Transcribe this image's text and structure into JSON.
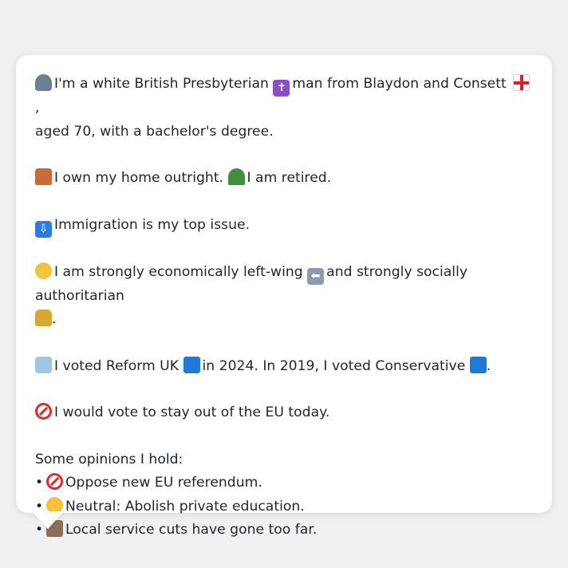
{
  "persona": {
    "intro": {
      "icon1": "person-icon",
      "text1": "I'm a white British Presbyterian",
      "icon2": "latin-cross-icon",
      "text2": "man from Blaydon and Consett",
      "icon3": "england-flag-icon",
      "text3": ",",
      "text4": "aged 70, with a bachelor's degree."
    },
    "home": {
      "icon1": "house-icon",
      "text1": "I own my home outright.",
      "icon2": "palm-tree-icon",
      "text2": "I am retired."
    },
    "issue": {
      "icon": "passport-control-icon",
      "text": "Immigration is my top issue."
    },
    "ideology": {
      "icon1": "thinking-face-icon",
      "text1": "I am strongly economically left-wing",
      "icon2": "left-arrow-icon",
      "text2": "and strongly socially authoritarian",
      "icon3": "lock-icon",
      "text3": "."
    },
    "vote": {
      "icon1": "ballot-box-icon",
      "text1": "I voted Reform UK",
      "icon2": "blue-square-icon",
      "text2": "in 2024. In 2019, I voted Conservative",
      "icon3": "blue-square-icon",
      "text3": "."
    },
    "eu": {
      "icon": "no-entry-icon",
      "text": "I would vote to stay out of the EU today."
    },
    "opinions": {
      "heading": "Some opinions I hold:",
      "bullet": "•",
      "items": [
        {
          "icon": "no-entry-icon",
          "text": "Oppose new EU referendum."
        },
        {
          "icon": "neutral-face-icon",
          "text": "Neutral: Abolish private education."
        },
        {
          "icon": "derelict-house-icon",
          "text": "Local service cuts have gone too far."
        }
      ]
    }
  },
  "colors": {
    "background": "#f0f1f3",
    "card": "#ffffff",
    "text": "#1e2530"
  }
}
